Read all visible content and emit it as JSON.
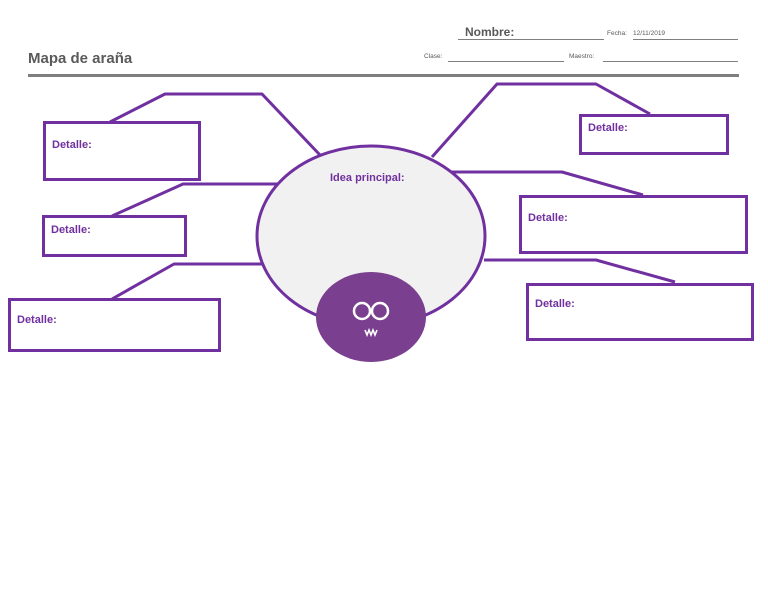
{
  "header": {
    "title": "Mapa de araña",
    "nombre_label": "Nombre:",
    "fecha_label": "Fecha:",
    "fecha_value": "12/11/2019",
    "clase_label": "Clase:",
    "maestro_label": "Maestro:"
  },
  "map": {
    "central_label": "Idea principal:",
    "details": [
      "Detalle:",
      "Detalle:",
      "Detalle:",
      "Detalle:",
      "Detalle:",
      "Detalle:"
    ]
  },
  "colors": {
    "accent": "#7030a0",
    "ellipse_fill": "#f2f1f1",
    "ellipse_stroke": "#7030a0",
    "spider_body": "#7a3f8f",
    "rule": "#7f7f7f"
  },
  "icons": {
    "mascot": "spider-face-icon"
  }
}
